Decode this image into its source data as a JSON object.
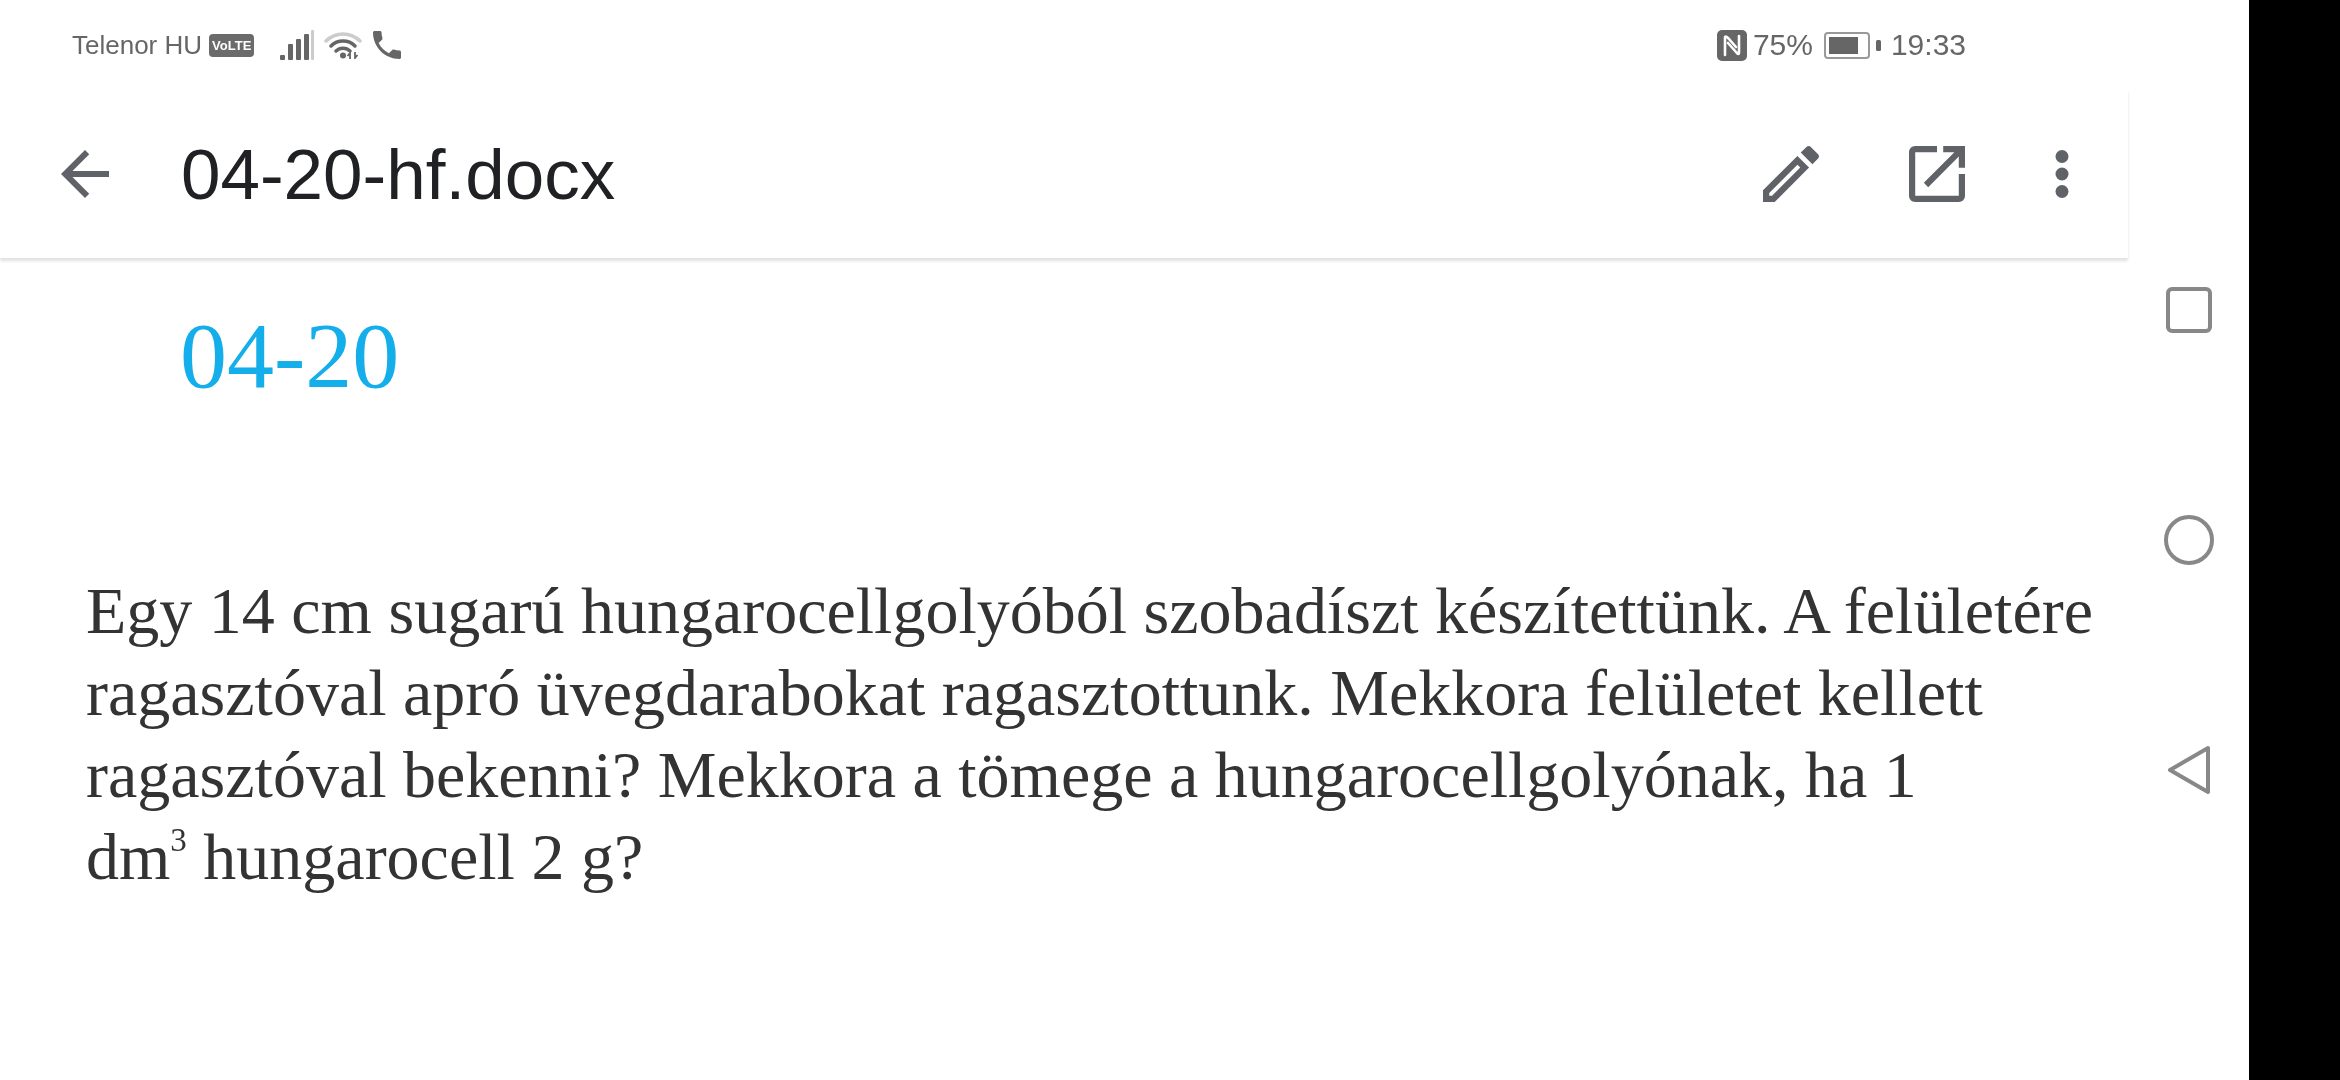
{
  "status_bar": {
    "carrier": "Telenor HU",
    "network_badge": "VoLTE",
    "battery_percent": "75%",
    "time": "19:33"
  },
  "toolbar": {
    "title": "04-20-hf.docx"
  },
  "document": {
    "heading": "04-20",
    "paragraph": "Egy 14 cm sugarú hungarocellgolyóból szobadíszt készítettünk. A felületére ragasztóval apró üvegdarabokat ragasztottunk. Mekkora felületet kellett ragasztóval bekenni? Mekkora a tömege a hungarocellgolyónak, ha 1\ndm$^{3}$ hungarocell 2 g?"
  }
}
